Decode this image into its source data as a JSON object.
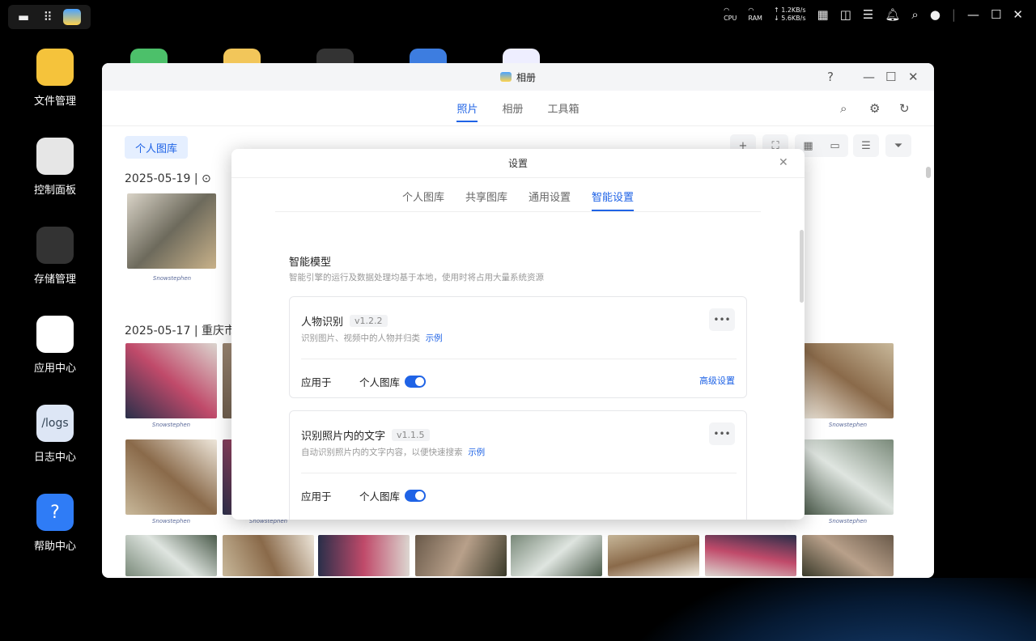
{
  "taskbar": {
    "tray": {
      "cpu": "CPU",
      "ram": "RAM",
      "up": "↑ 1.2KB/s",
      "down": "↓ 5.6KB/s"
    }
  },
  "dock": [
    {
      "label": "文件管理",
      "icon": "folder-icon",
      "color": "#f5c33b"
    },
    {
      "label": "控制面板",
      "icon": "sliders-icon",
      "color": "#e6e6e6"
    },
    {
      "label": "存储管理",
      "icon": "storage-icon",
      "color": "#333333"
    },
    {
      "label": "应用中心",
      "icon": "app-center-icon",
      "color": "#ffffff"
    },
    {
      "label": "日志中心",
      "icon": "logs-icon",
      "color": "#dde6f5",
      "text": "/logs"
    },
    {
      "label": "帮助中心",
      "icon": "help-icon",
      "color": "#2f7cf6",
      "text": "?"
    }
  ],
  "window": {
    "title": "相册",
    "help": "?",
    "tabs": [
      "照片",
      "相册",
      "工具箱"
    ],
    "active_tab": "照片",
    "library_pill": "个人图库",
    "groups": [
      {
        "date": "2025-05-19",
        "sep": "|"
      },
      {
        "date": "2025-05-17",
        "sep": "|",
        "location": "重庆市"
      }
    ],
    "watermark": "Snowstephen"
  },
  "modal": {
    "title": "设置",
    "tabs": [
      "个人图库",
      "共享图库",
      "通用设置",
      "智能设置"
    ],
    "active_tab": "智能设置",
    "section_title": "智能模型",
    "section_desc": "智能引擎的运行及数据处理均基于本地，使用时将占用大量系统资源",
    "cards": [
      {
        "name": "人物识别",
        "version": "v1.2.2",
        "desc": "识别图片、视频中的人物并归类",
        "example": "示例",
        "apply_label": "应用于",
        "library": "个人图库",
        "enabled": true,
        "advanced": "高级设置"
      },
      {
        "name": "识别照片内的文字",
        "version": "v1.1.5",
        "desc": "自动识别照片内的文字内容，以便快速搜索",
        "example": "示例",
        "apply_label": "应用于",
        "library": "个人图库",
        "enabled": true
      }
    ]
  },
  "colors": {
    "accent": "#1f63e6"
  }
}
